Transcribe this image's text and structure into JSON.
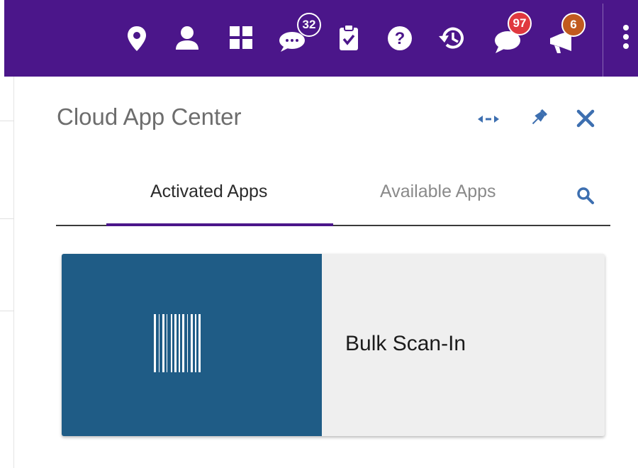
{
  "topbar": {
    "icons": [
      "location-pin-icon",
      "user-icon",
      "app-grid-icon",
      "chat-icon",
      "clipboard-check-icon",
      "help-icon",
      "history-icon",
      "alerts-icon",
      "announcements-icon",
      "more-vertical-icon"
    ],
    "badges": {
      "chat": "32",
      "alerts": "97",
      "announcements": "6"
    },
    "colors": {
      "background": "#4b168a",
      "chat_badge": "#4b168a",
      "alerts_badge": "#e0383e",
      "announcements_badge": "#c15a1e"
    }
  },
  "panel": {
    "title": "Cloud App Center",
    "header_icons": [
      "expand-horizontal-icon",
      "pin-icon",
      "close-icon"
    ],
    "tabs": [
      {
        "label": "Activated Apps",
        "active": true
      },
      {
        "label": "Available Apps",
        "active": false
      }
    ],
    "search_icon": "search-icon"
  },
  "apps": [
    {
      "name": "Bulk Scan-In",
      "icon": "barcode-icon",
      "tile_color": "#1f5c86"
    }
  ]
}
